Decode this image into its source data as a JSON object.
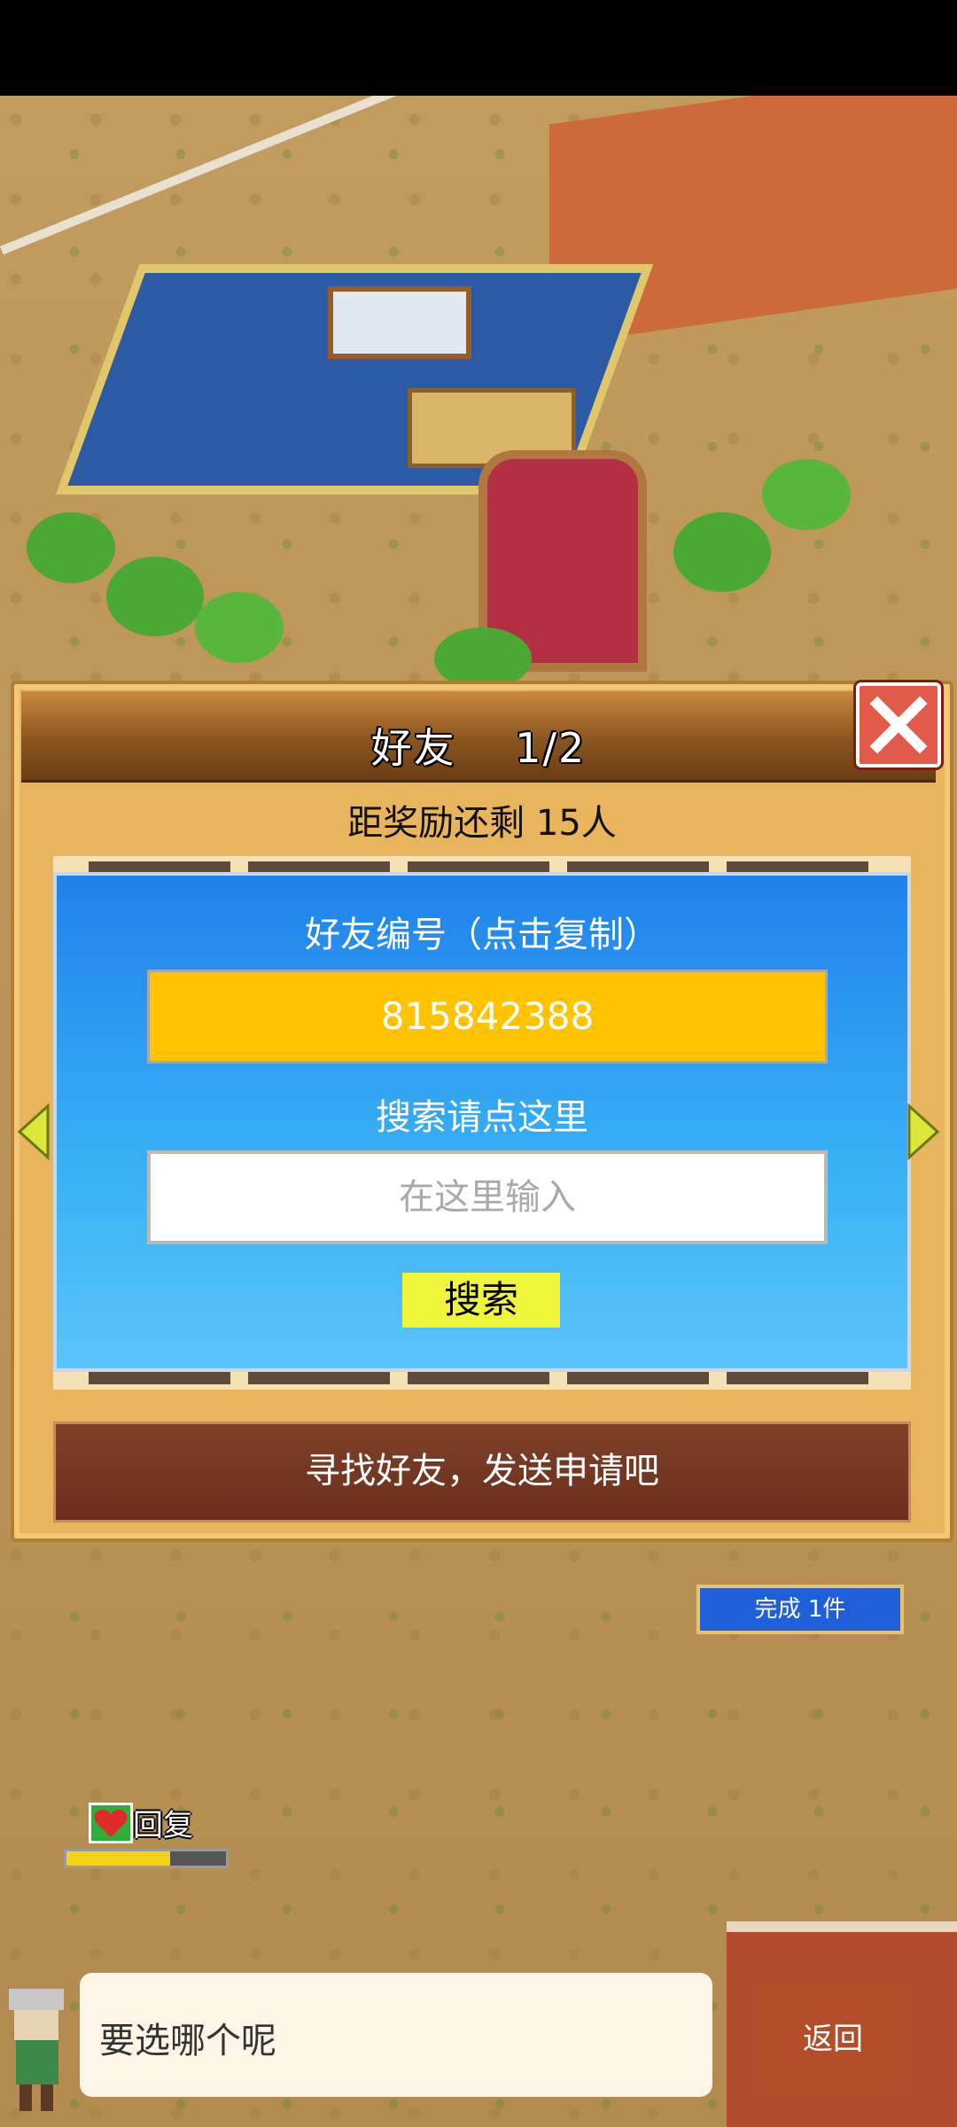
{
  "dialog": {
    "title": "好友    1/2",
    "reward_text": "距奖励还剩 15人",
    "friend_id_label": "好友编号（点击复制）",
    "friend_id": "815842388",
    "search_label": "搜索请点这里",
    "search_placeholder": "在这里输入",
    "search_button": "搜索",
    "action_button": "寻找好友，发送申请吧"
  },
  "hud": {
    "complete_badge": "完成 1件",
    "recover_label": "回复",
    "recover_progress": 0.65,
    "speech_text": "要选哪个呢",
    "back_button": "返回"
  },
  "colors": {
    "panel_blue": "#1f82ea",
    "id_box": "#ffc300",
    "search_button": "#f0f53c",
    "close_button": "#e25a4a"
  },
  "icons": [
    "close-icon",
    "arrow-left-icon",
    "arrow-right-icon",
    "heart-icon",
    "avatar-icon"
  ]
}
